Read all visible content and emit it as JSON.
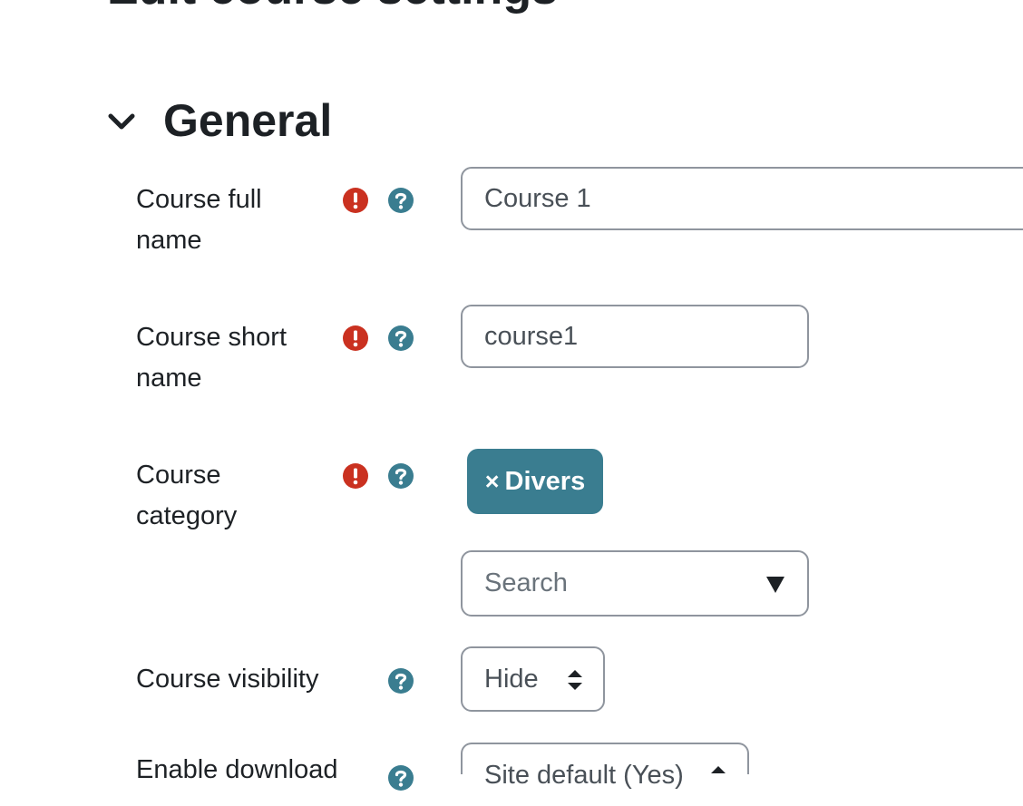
{
  "page": {
    "heading": "Edit course settings"
  },
  "section": {
    "title": "General"
  },
  "fields": {
    "fullname": {
      "label": "Course full name",
      "value": "Course 1"
    },
    "shortname": {
      "label": "Course short name",
      "value": "course1"
    },
    "category": {
      "label": "Course category",
      "selected": "Divers",
      "remove_symbol": "×",
      "search_placeholder": "Search"
    },
    "visibility": {
      "label": "Course visibility",
      "value": "Hide"
    },
    "download": {
      "label": "Enable download",
      "value": "Site default (Yes)"
    }
  },
  "colors": {
    "required_icon": "#ca3120",
    "help_icon": "#3a7d90",
    "chip_background": "#3a7d90",
    "border": "#8f959e"
  },
  "icons": {
    "section_toggle": "chevron-down-icon",
    "required": "exclamation-circle-icon",
    "help": "question-circle-icon",
    "search_dropdown": "caret-down-icon",
    "select": "sort-arrows-icon"
  }
}
